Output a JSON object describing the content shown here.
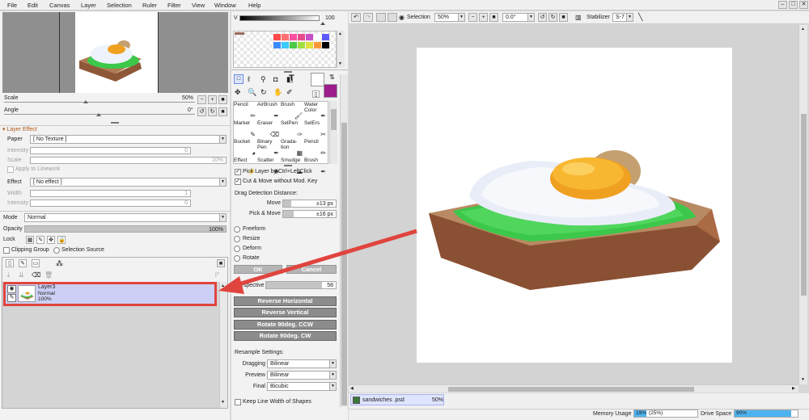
{
  "menu": [
    "File",
    "Edit",
    "Canvas",
    "Layer",
    "Selection",
    "Ruler",
    "Filter",
    "View",
    "Window",
    "Help"
  ],
  "window_controls": [
    "–",
    "□",
    "✕"
  ],
  "navigator": {
    "scale_label": "Scale",
    "scale_value": "50%",
    "angle_label": "Angle",
    "angle_value": "0°"
  },
  "layer_effect": {
    "header": "Layer Effect",
    "paper_label": "Paper",
    "paper_value": "[ No Texture ]",
    "intensity_label": "Intensity",
    "intensity_value": "0",
    "scale_label": "Scale",
    "scale_value": "10%",
    "apply_linework": "Apply to Linework",
    "effect_label": "Effect",
    "effect_value": "[ No effect ]",
    "width_label": "Width",
    "width_value": "1",
    "intensity2_label": "Intensity",
    "intensity2_value": "0"
  },
  "layer_props": {
    "mode_label": "Mode",
    "mode_value": "Normal",
    "opacity_label": "Opacity",
    "opacity_value": "100%",
    "opacity_level": 1.0,
    "lock_label": "Lock",
    "clipping_group": "Clipping Group",
    "selection_source": "Selection Source"
  },
  "layer": {
    "name": "Layer3",
    "mode": "Normal",
    "opacity": "100%"
  },
  "color": {
    "v_label": "V",
    "v_value": "100",
    "fg": "#ffffff",
    "bg": "#9b1e8c",
    "palette": [
      "#ff4a4a",
      "#ff7070",
      "#ff4fa0",
      "#e74b8c",
      "#c84fc8",
      "#ffffff",
      "#5a5aff",
      "#3c8cff",
      "#3cc8ff",
      "#4ac84a",
      "#a0e040",
      "#e0e040",
      "#ff9a3c",
      "#000000"
    ]
  },
  "tools": [
    "Pencil",
    "AirBrush",
    "Brush",
    "Water Color",
    "Marker",
    "Eraser",
    "SelPen",
    "SelErs",
    "Bucket",
    "Binary Pen",
    "Grada-tion",
    "Pencil",
    "Effect",
    "Scatter",
    "Smudge",
    "Brush"
  ],
  "transform": {
    "pick_layer": "Pick Layer by Ctrl+LeftClick",
    "cut_move": "Cut & Move without Mod. Key",
    "drag_dist": "Drag Detection Distance:",
    "move_label": "Move",
    "move_value": "±13 px",
    "move_level": 0.16,
    "pickmove_label": "Pick & Move",
    "pickmove_value": "±16 px",
    "pickmove_level": 0.2,
    "modes": [
      "Freeform",
      "Resize",
      "Deform",
      "Rotate"
    ],
    "ok": "OK",
    "cancel": "Cancel",
    "perspective_label": "Perspective",
    "perspective_value": "58",
    "perspective_level": 0.8,
    "actions": [
      "Reverse Horizontal",
      "Reverse Vertical",
      "Rotate 90deg. CCW",
      "Rotate 90deg. CW"
    ],
    "resample_title": "Resample Settings:",
    "dragging_label": "Dragging",
    "dragging_value": "Bilinear",
    "preview_label": "Preview",
    "preview_value": "Bilinear",
    "final_label": "Final",
    "final_value": "Bicubic",
    "keep_line": "Keep Line Width of Shapes"
  },
  "toolbar": {
    "selection_label": "Selection",
    "zoom": "50%",
    "angle": "0.0°",
    "stabilizer_label": "Stabilizer",
    "stabilizer_value": "S-7"
  },
  "document": {
    "name": "sandwiches .psd",
    "zoom": "50%"
  },
  "status": {
    "memory_label": "Memory Usage",
    "memory_value": "19%",
    "memory_extra": "(25%)",
    "memory_level": 0.19,
    "drive_label": "Drive Space",
    "drive_value": "90%",
    "drive_level": 0.9
  }
}
